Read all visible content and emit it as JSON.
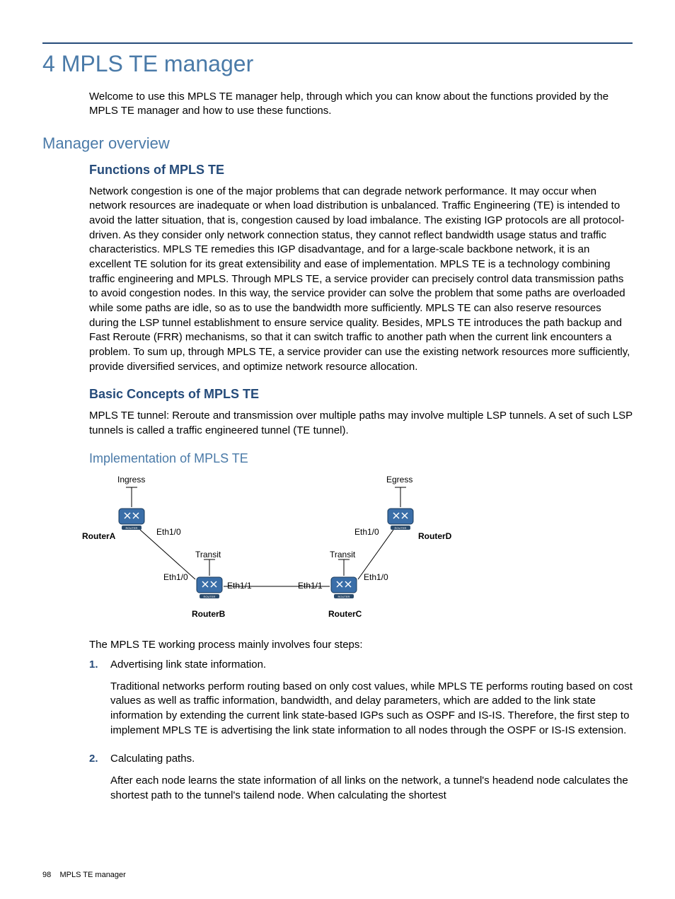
{
  "chapter_title": "4 MPLS TE manager",
  "intro": "Welcome to use this MPLS TE manager help, through which you can know about the functions provided by the MPLS TE manager and how to use these functions.",
  "sections": {
    "overview_title": "Manager overview",
    "functions_title": "Functions of MPLS TE",
    "functions_body": "Network congestion is one of the major problems that can degrade network performance. It may occur when network resources are inadequate or when load distribution is unbalanced. Traffic Engineering (TE) is intended to avoid the latter situation, that is, congestion caused by load imbalance. The existing IGP protocols are all protocol-driven. As they consider only network connection status, they cannot reflect bandwidth usage status and traffic characteristics. MPLS TE remedies this IGP disadvantage, and for a large-scale backbone network, it is an excellent TE solution for its great extensibility and ease of implementation. MPLS TE is a technology combining traffic engineering and MPLS. Through MPLS TE, a service provider can precisely control data transmission paths to avoid congestion nodes. In this way, the service provider can solve the problem that some paths are overloaded while some paths are idle, so as to use the bandwidth more sufficiently. MPLS TE can also reserve resources during the LSP tunnel establishment to ensure service quality. Besides, MPLS TE introduces the path backup and Fast Reroute (FRR) mechanisms, so that it can switch traffic to another path when the current link encounters a problem. To sum up, through MPLS TE, a service provider can use the existing network resources more sufficiently, provide diversified services, and optimize network resource allocation.",
    "concepts_title": "Basic Concepts of MPLS TE",
    "concepts_body": "MPLS TE tunnel: Reroute and transmission over multiple paths may involve multiple LSP tunnels. A set of such LSP tunnels is called a traffic engineered tunnel (TE tunnel).",
    "impl_title": "Implementation of MPLS TE"
  },
  "diagram": {
    "ingress": "Ingress",
    "egress": "Egress",
    "transit1": "Transit",
    "transit2": "Transit",
    "routerA": "RouterA",
    "routerB": "RouterB",
    "routerC": "RouterC",
    "routerD": "RouterD",
    "ifA": "Eth1/0",
    "ifD": "Eth1/0",
    "ifB_left": "Eth1/0",
    "ifB_right": "Eth1/1",
    "ifC_left": "Eth1/1",
    "ifC_right": "Eth1/0"
  },
  "process_intro": "The MPLS TE working process mainly involves four steps:",
  "steps": [
    {
      "num": "1.",
      "title": "Advertising link state information.",
      "desc": "Traditional networks perform routing based on only cost values, while MPLS TE performs routing based on cost values as well as traffic information, bandwidth, and delay parameters, which are added to the link state information by extending the current link state-based IGPs such as OSPF and IS-IS. Therefore, the first step to implement MPLS TE is advertising the link state information to all nodes through the OSPF or IS-IS extension."
    },
    {
      "num": "2.",
      "title": "Calculating paths.",
      "desc": "After each node learns the state information of all links on the network, a tunnel's headend node calculates the shortest path to the tunnel's tailend node. When calculating the shortest"
    }
  ],
  "footer": {
    "page": "98",
    "label": "MPLS TE manager"
  }
}
